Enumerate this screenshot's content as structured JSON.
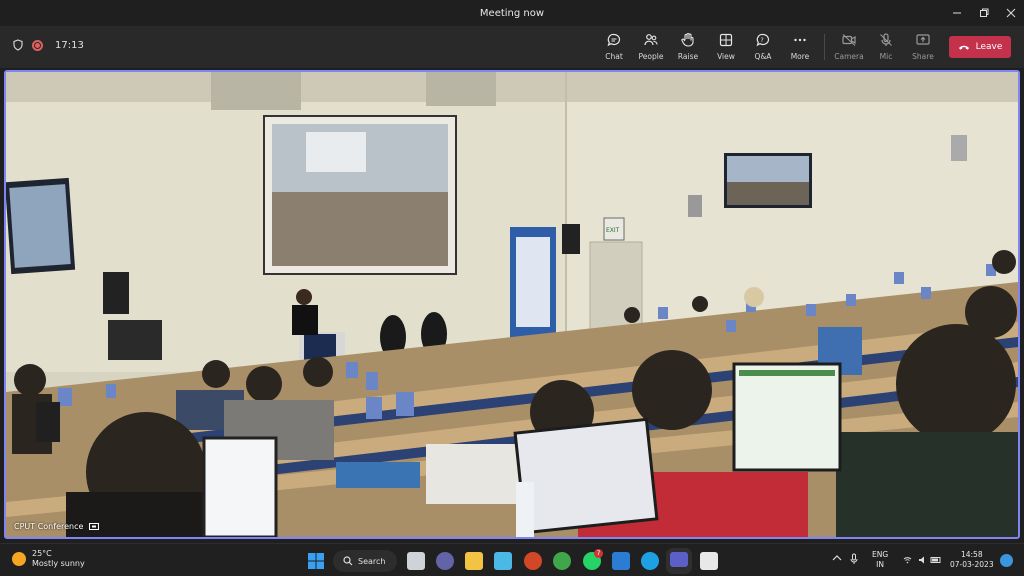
{
  "window": {
    "title": "Meeting now"
  },
  "toolbar": {
    "time": "17:13",
    "buttons": [
      {
        "label": "Chat",
        "icon": "chat-icon"
      },
      {
        "label": "People",
        "icon": "people-icon"
      },
      {
        "label": "Raise",
        "icon": "raise-hand-icon"
      },
      {
        "label": "View",
        "icon": "view-icon"
      },
      {
        "label": "Q&A",
        "icon": "qa-icon"
      },
      {
        "label": "More",
        "icon": "more-icon"
      },
      {
        "label": "Camera",
        "icon": "camera-icon"
      },
      {
        "label": "Mic",
        "icon": "mic-icon"
      },
      {
        "label": "Share",
        "icon": "share-icon"
      }
    ],
    "leave_label": "Leave",
    "colors": {
      "leave": "#c4314b",
      "stage_border": "#7f85f5"
    }
  },
  "stage": {
    "participant_name": "CPUT Conference",
    "scene_sign": "EXIT"
  },
  "taskbar": {
    "weather_temp": "25°C",
    "weather_desc": "Mostly sunny",
    "search_label": "Search",
    "whatsapp_badge": "7",
    "language_line1": "ENG",
    "language_line2": "IN",
    "clock_time": "14:58",
    "clock_date": "07-03-2023"
  }
}
